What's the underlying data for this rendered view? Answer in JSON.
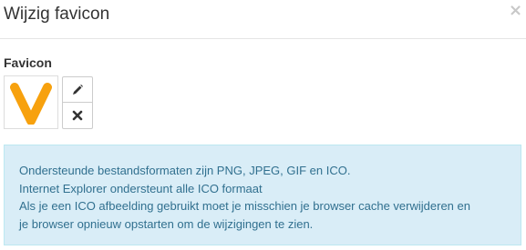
{
  "modal": {
    "title": "Wijzig favicon",
    "close_label": "×"
  },
  "favicon": {
    "label": "Favicon",
    "image_icon": "orange-v-logo",
    "edit_icon": "pencil-icon",
    "remove_icon": "times-icon"
  },
  "info": {
    "lines": [
      "Ondersteunde bestandsformaten zijn PNG, JPEG, GIF en ICO.",
      "Internet Explorer ondersteunt alle ICO formaat",
      "Als je een ICO afbeelding gebruikt moet je misschien je browser cache verwijderen en",
      "je browser opnieuw opstarten om de wijzigingen te zien."
    ]
  },
  "colors": {
    "logo_orange": "#f7a10e",
    "info_background": "#d9edf7",
    "info_border": "#bce8f1",
    "info_text": "#31708f"
  }
}
